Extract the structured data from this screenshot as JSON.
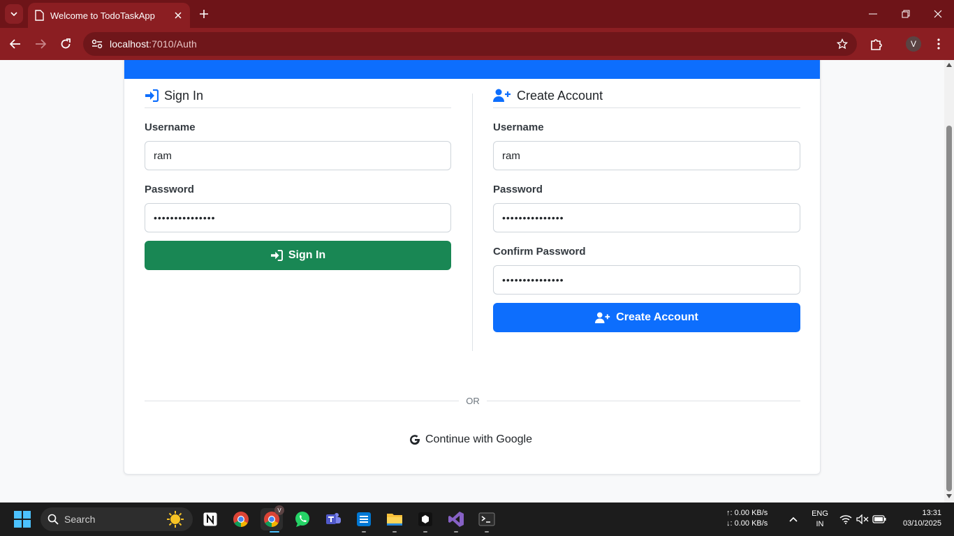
{
  "browser": {
    "tab_title": "Welcome to TodoTaskApp",
    "url_host": "localhost",
    "url_path": ":7010/Auth",
    "profile_initial": "V"
  },
  "signin": {
    "title": "Sign In",
    "username_label": "Username",
    "username_value": "ram",
    "password_label": "Password",
    "password_value": "•••••••••••••••",
    "button_label": "Sign In"
  },
  "create": {
    "title": "Create Account",
    "username_label": "Username",
    "username_value": "ram",
    "password_label": "Password",
    "password_value": "•••••••••••••••",
    "confirm_label": "Confirm Password",
    "confirm_value": "•••••••••••••••",
    "button_label": "Create Account"
  },
  "divider_text": "OR",
  "google_label": "Continue with Google",
  "colors": {
    "primary": "#0d6efd",
    "success": "#198754",
    "browser_frame": "#8b1e22"
  },
  "taskbar": {
    "search_placeholder": "Search",
    "net_up": "↑: 0.00 KB/s",
    "net_down": "↓: 0.00 KB/s",
    "lang_top": "ENG",
    "lang_bottom": "IN",
    "time": "13:31",
    "date": "03/10/2025",
    "chrome_badge": "V"
  }
}
